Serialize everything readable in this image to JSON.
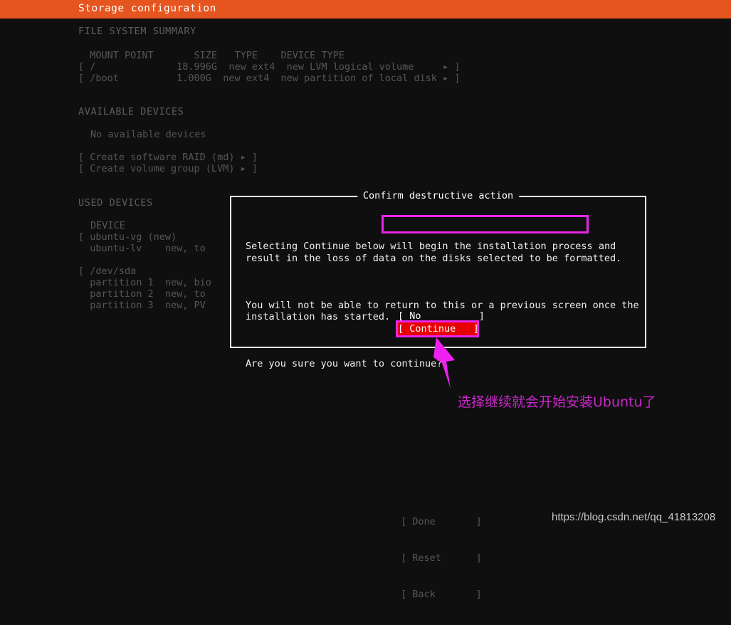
{
  "header": {
    "title": "Storage configuration"
  },
  "file_system_summary": {
    "section_label": "FILE SYSTEM SUMMARY",
    "columns": [
      "MOUNT POINT",
      "SIZE",
      "TYPE",
      "DEVICE TYPE"
    ],
    "header_row": "  MOUNT POINT       SIZE   TYPE    DEVICE TYPE",
    "rows": [
      {
        "raw": "[ /              18.996G  new ext4  new LVM logical volume     ▸ ]",
        "mount_point": "/",
        "size": "18.996G",
        "type": "new ext4",
        "device_type": "new LVM logical volume"
      },
      {
        "raw": "[ /boot          1.000G  new ext4  new partition of local disk ▸ ]",
        "mount_point": "/boot",
        "size": "1.000G",
        "type": "new ext4",
        "device_type": "new partition of local disk"
      }
    ]
  },
  "available_devices": {
    "section_label": "AVAILABLE DEVICES",
    "empty_message": "No available devices",
    "actions": [
      "[ Create software RAID (md) ▸ ]",
      "[ Create volume group (LVM) ▸ ]"
    ]
  },
  "used_devices": {
    "section_label": "USED DEVICES",
    "column_label": "DEVICE",
    "rows": [
      "[ ubuntu-vg (new)",
      "  ubuntu-lv    new, to",
      "",
      "[ /dev/sda",
      "  partition 1  new, bio",
      "  partition 2  new, to",
      "  partition 3  new, PV"
    ]
  },
  "dialog": {
    "title": "Confirm destructive action",
    "paragraph1_before": "Selecting Continue below ",
    "paragraph1_highlight": "will begin the installation process",
    "paragraph1_after": " and",
    "paragraph1_line2": "result in the loss of data on the disks selected to be formatted.",
    "paragraph2_line1": "You will not be able to return to this or a previous screen once the",
    "paragraph2_line2": "installation has started.",
    "paragraph3": "Are you sure you want to continue?",
    "buttons": {
      "no": "[ No          ]",
      "continue": "[ Continue   ]"
    }
  },
  "bottom_buttons": [
    "[ Done       ]",
    "[ Reset      ]",
    "[ Back       ]"
  ],
  "annotation": {
    "caption": "选择继续就会开始安装Ubuntu了",
    "arrow_icon": "up-left-arrow-icon"
  },
  "watermark": "https://blog.csdn.net/qq_41813208",
  "colors": {
    "header_bg": "#e6551f",
    "screen_bg": "#0f0f10",
    "dim_text": "#565656",
    "dialog_text": "#f0f0f0",
    "annotation_magenta": "#e826e8",
    "caption_purple": "#c828c8",
    "continue_red": "#e80000"
  }
}
